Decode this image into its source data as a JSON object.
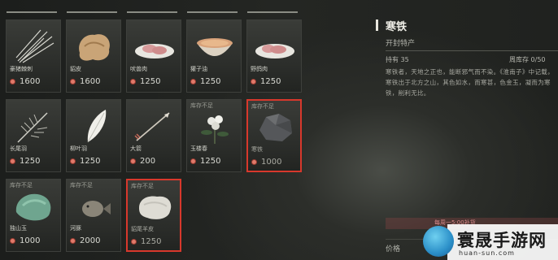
{
  "shop": {
    "items": [
      {
        "name": "豪猪棘刺",
        "price": "1600",
        "stock": "",
        "icon": "quills-icon"
      },
      {
        "name": "貂皮",
        "price": "1600",
        "stock": "",
        "icon": "fur-icon"
      },
      {
        "name": "吠兽肉",
        "price": "1250",
        "stock": "",
        "icon": "meat-icon"
      },
      {
        "name": "獾子油",
        "price": "1250",
        "stock": "",
        "icon": "oil-bowl-icon"
      },
      {
        "name": "野鸽肉",
        "price": "1250",
        "stock": "",
        "icon": "meat-icon"
      },
      {
        "name": "长尾羽",
        "price": "1250",
        "stock": "",
        "icon": "long-feather-icon"
      },
      {
        "name": "柳叶羽",
        "price": "1250",
        "stock": "",
        "icon": "feather-icon"
      },
      {
        "name": "大箭",
        "price": "200",
        "stock": "",
        "icon": "arrow-icon"
      },
      {
        "name": "玉楼春",
        "price": "1250",
        "stock": "库存不足",
        "icon": "flower-icon"
      },
      {
        "name": "寒铁",
        "price": "1000",
        "stock": "库存不足",
        "icon": "ore-icon",
        "selected": true
      },
      {
        "name": "独山玉",
        "price": "1000",
        "stock": "库存不足",
        "icon": "jade-icon"
      },
      {
        "name": "河豚",
        "price": "2000",
        "stock": "库存不足",
        "icon": "fish-icon"
      },
      {
        "name": "貂尾羊皮",
        "price": "1250",
        "stock": "库存不足",
        "icon": "pelt-icon",
        "selected": true
      }
    ]
  },
  "detail": {
    "title": "寒铁",
    "subtitle": "开封特产",
    "owned": "持有 35",
    "weekly_stock": "周库存 0/50",
    "description": "寒铁者，天地之正也，能断邪气而不染。《淮南子》中记载，寒铁出于北方之山，其色如水，而寒甚，色金玉，凝而为寒铁，削利无比。",
    "refresh": "每周一5:00补货",
    "price_label": "价格"
  },
  "watermark": {
    "text": "寰晟手游网",
    "url": "huan-sun.com"
  }
}
